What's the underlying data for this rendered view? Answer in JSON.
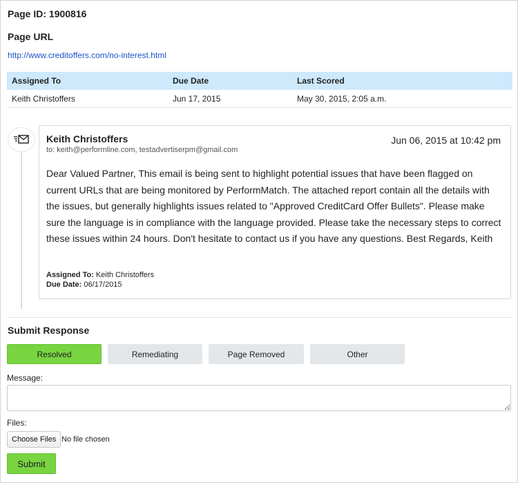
{
  "page": {
    "id_label": "Page ID: 1900816",
    "url_label": "Page URL",
    "url": "http://www.creditoffers.com/no-interest.html"
  },
  "assignment_table": {
    "headers": [
      "Assigned To",
      "Due Date",
      "Last Scored"
    ],
    "row": [
      "Keith Christoffers",
      "Jun 17, 2015",
      "May 30, 2015, 2:05 a.m."
    ]
  },
  "message_card": {
    "icon": "mail-icon",
    "sender": "Keith Christoffers",
    "recipients": "to: keith@performline.com, testadvertiserpm@gmail.com",
    "date": "Jun 06, 2015 at 10:42 pm",
    "body": "Dear Valued Partner, This email is being sent to highlight potential issues that have been flagged on current URLs that are being monitored by PerformMatch. The attached report contain all the details with the issues, but generally highlights issues related to \"Approved CreditCard Offer Bullets\". Please make sure the language is in compliance with the language provided. Please take the necessary steps to correct these issues within 24 hours. Don't hesitate to contact us if you have any questions. Best Regards, Keith",
    "assigned_to_label": "Assigned To:",
    "assigned_to_value": "Keith Christoffers",
    "due_date_label": "Due Date:",
    "due_date_value": "06/17/2015"
  },
  "submit_response": {
    "title": "Submit Response",
    "buttons": [
      "Resolved",
      "Remediating",
      "Page Removed",
      "Other"
    ],
    "selected": "Resolved",
    "message_label": "Message:",
    "message_value": "",
    "files_label": "Files:",
    "choose_files_label": "Choose Files",
    "file_status": "No file chosen",
    "submit_label": "Submit"
  },
  "colors": {
    "table_header_bg": "#cde9fb",
    "active_button_bg": "#78d440",
    "inactive_button_bg": "#e4e7ea",
    "link": "#1a55c8"
  }
}
